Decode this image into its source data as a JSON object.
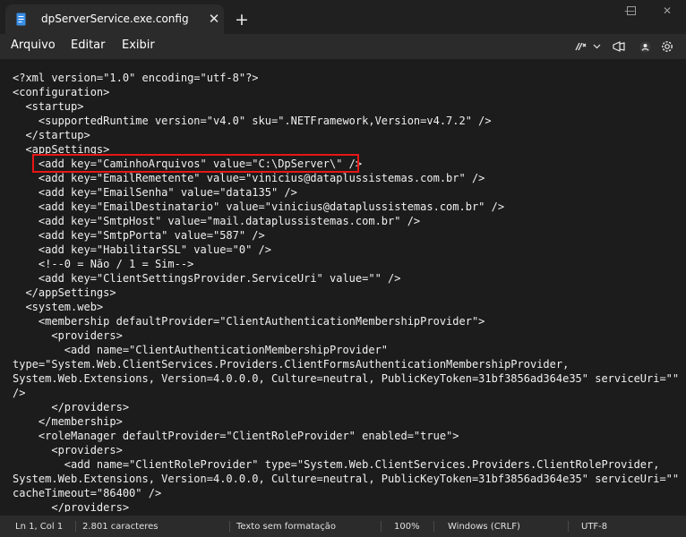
{
  "window": {
    "tab_title": "dpServerService.exe.config",
    "close_tab_glyph": "✕",
    "new_tab_glyph": "+",
    "minimize_glyph": "—",
    "maximize_glyph": "☐",
    "close_glyph": "✕"
  },
  "menu": {
    "items": [
      "Arquivo",
      "Editar",
      "Exibir"
    ],
    "icons": [
      "copilot-icon",
      "chevron-down-icon",
      "feedback-icon",
      "account-icon",
      "settings-icon"
    ]
  },
  "editor": {
    "lines": [
      "<?xml version=\"1.0\" encoding=\"utf-8\"?>",
      "<configuration>",
      "  <startup>",
      "    <supportedRuntime version=\"v4.0\" sku=\".NETFramework,Version=v4.7.2\" />",
      "  </startup>",
      "  <appSettings>",
      "    <add key=\"CaminhoArquivos\" value=\"C:\\DpServer\\\" />",
      "    <add key=\"EmailRemetente\" value=\"vinicius@dataplussistemas.com.br\" />",
      "    <add key=\"EmailSenha\" value=\"data135\" />",
      "    <add key=\"EmailDestinatario\" value=\"vinicius@dataplussistemas.com.br\" />",
      "    <add key=\"SmtpHost\" value=\"mail.dataplussistemas.com.br\" />",
      "    <add key=\"SmtpPorta\" value=\"587\" />",
      "    <add key=\"HabilitarSSL\" value=\"0\" />",
      "    <!--0 = Não / 1 = Sim-->",
      "    <add key=\"ClientSettingsProvider.ServiceUri\" value=\"\" />",
      "  </appSettings>",
      "  <system.web>",
      "    <membership defaultProvider=\"ClientAuthenticationMembershipProvider\">",
      "      <providers>",
      "        <add name=\"ClientAuthenticationMembershipProvider\"",
      "type=\"System.Web.ClientServices.Providers.ClientFormsAuthenticationMembershipProvider,",
      "System.Web.Extensions, Version=4.0.0.0, Culture=neutral, PublicKeyToken=31bf3856ad364e35\" serviceUri=\"\"",
      "/>",
      "      </providers>",
      "    </membership>",
      "    <roleManager defaultProvider=\"ClientRoleProvider\" enabled=\"true\">",
      "      <providers>",
      "        <add name=\"ClientRoleProvider\" type=\"System.Web.ClientServices.Providers.ClientRoleProvider,",
      "System.Web.Extensions, Version=4.0.0.0, Culture=neutral, PublicKeyToken=31bf3856ad364e35\" serviceUri=\"\"",
      "cacheTimeout=\"86400\" />",
      "      </providers>"
    ],
    "highlight_color": "#e81616"
  },
  "status": {
    "position": "Ln 1, Col 1",
    "characters": "2.801 caracteres",
    "format": "Texto sem formatação",
    "zoom": "100%",
    "line_ending": "Windows (CRLF)",
    "encoding": "UTF-8"
  }
}
